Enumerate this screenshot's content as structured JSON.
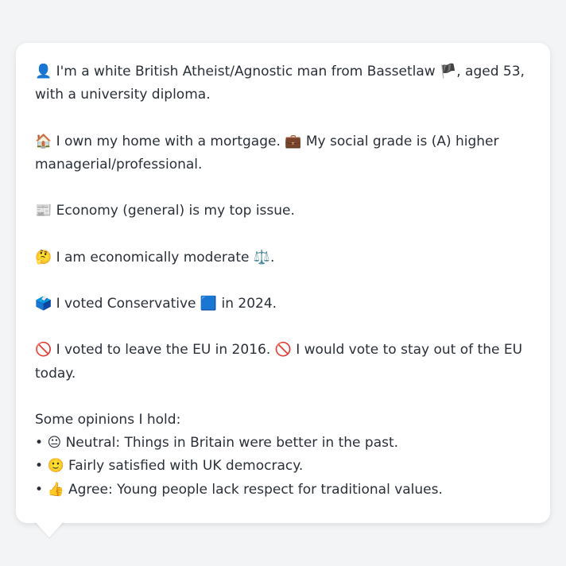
{
  "profile": {
    "identity": {
      "icon": "👤",
      "text_before_flag": "I'm a white British Atheist/Agnostic man from Bassetlaw",
      "flag": "🏴",
      "text_after_flag": ", aged 53, with a university diploma."
    },
    "home": {
      "icon": "🏠",
      "text": "I own my home with a mortgage.",
      "grade_icon": "💼",
      "grade_text": "My social grade is (A) higher managerial/professional."
    },
    "issue": {
      "icon": "📰",
      "text": "Economy (general) is my top issue."
    },
    "economics": {
      "icon": "🤔",
      "text": "I am economically moderate",
      "scale_icon": "⚖️",
      "end": "."
    },
    "vote": {
      "icon": "🗳️",
      "text_before": "I voted Conservative",
      "party_icon": "🟦",
      "text_after": "in 2024."
    },
    "brexit": {
      "icon1": "🚫",
      "text1": "I voted to leave the EU in 2016.",
      "icon2": "🚫",
      "text2": "I would vote to stay out of the EU today."
    },
    "opinions": {
      "heading": "Some opinions I hold:",
      "bullet": "•",
      "items": [
        {
          "icon": "😐",
          "text": "Neutral: Things in Britain were better in the past."
        },
        {
          "icon": "🙂",
          "text": "Fairly satisfied with UK democracy."
        },
        {
          "icon": "👍",
          "text": "Agree: Young people lack respect for traditional values."
        }
      ]
    }
  },
  "colors": {
    "background": "#f3f4f6",
    "bubble": "#ffffff",
    "text": "#2a2f38"
  }
}
